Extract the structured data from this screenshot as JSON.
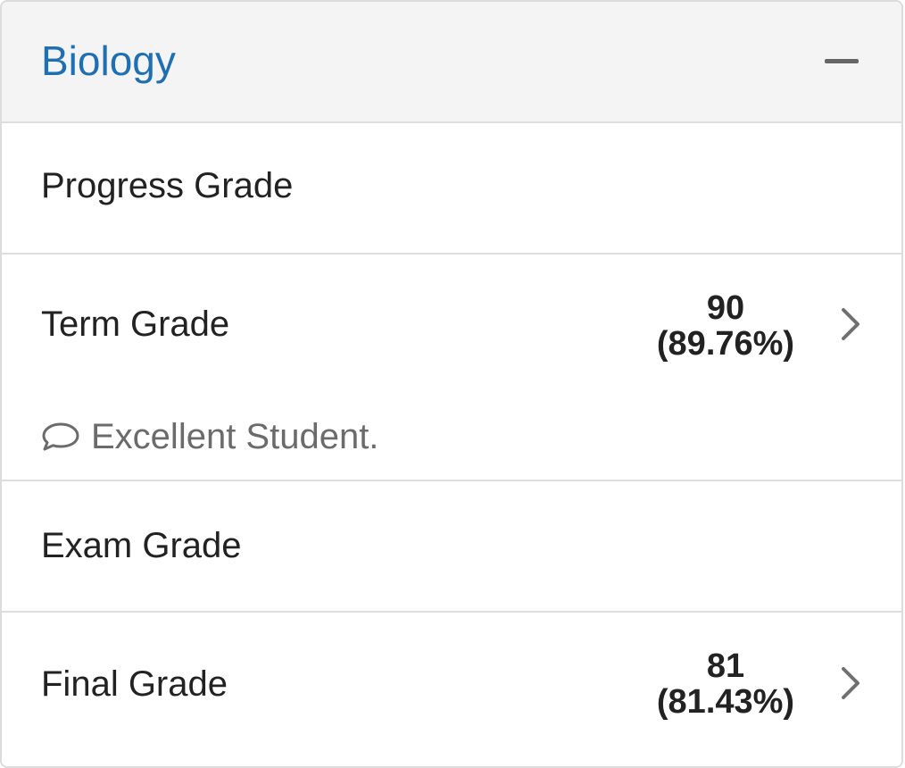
{
  "course": {
    "title": "Biology"
  },
  "rows": {
    "progress": {
      "label": "Progress Grade"
    },
    "term": {
      "label": "Term Grade",
      "grade": "90",
      "percent": "(89.76%)",
      "comment": "Excellent Student."
    },
    "exam": {
      "label": "Exam Grade"
    },
    "final": {
      "label": "Final Grade",
      "grade": "81",
      "percent": "(81.43%)"
    }
  },
  "icons": {
    "collapse": "minus-icon",
    "chevron": "chevron-right-icon",
    "comment": "speech-bubble-icon"
  },
  "colors": {
    "title": "#1f6fb3",
    "header_bg": "#f4f4f4",
    "divider": "#dedede",
    "text": "#222222",
    "muted": "#6b6b6b"
  }
}
